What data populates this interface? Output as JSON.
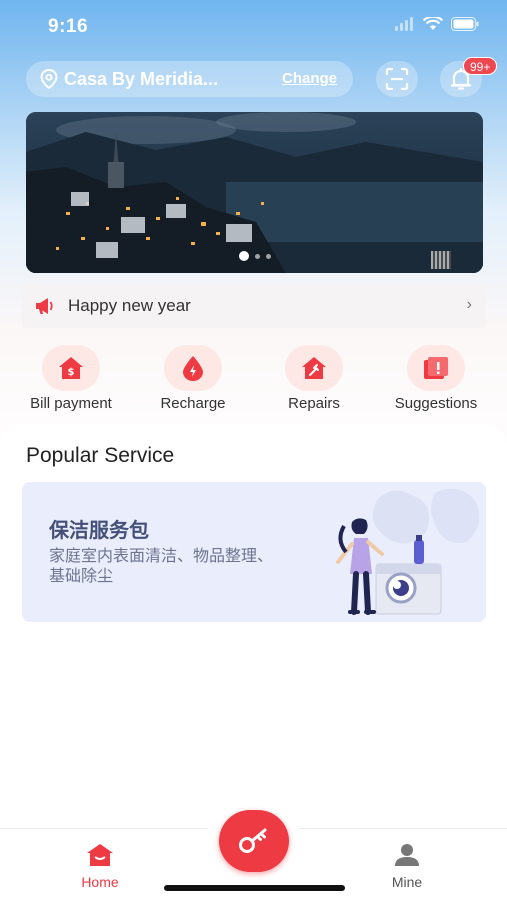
{
  "status_bar": {
    "time": "9:16"
  },
  "header": {
    "location_name": "Casa By Meridia...",
    "change_label": "Change",
    "notification_badge": "99+"
  },
  "banner": {
    "slide_count": 3,
    "active_slide": 1
  },
  "notice": {
    "text": "Happy new year"
  },
  "quick_actions": [
    {
      "label": "Bill payment",
      "icon": "bill-icon"
    },
    {
      "label": "Recharge",
      "icon": "recharge-icon"
    },
    {
      "label": "Repairs",
      "icon": "repairs-icon"
    },
    {
      "label": "Suggestions",
      "icon": "suggestions-icon"
    }
  ],
  "popular": {
    "section_title": "Popular Service",
    "card": {
      "title": "保洁服务包",
      "description": "家庭室内表面清洁、物品整理、基础除尘"
    }
  },
  "tabbar": {
    "home_label": "Home",
    "mine_label": "Mine",
    "active_color": "#ee3a42",
    "inactive_color": "#666666"
  },
  "colors": {
    "accent": "#ee3a42",
    "icon_bg": "#fde8e6"
  }
}
